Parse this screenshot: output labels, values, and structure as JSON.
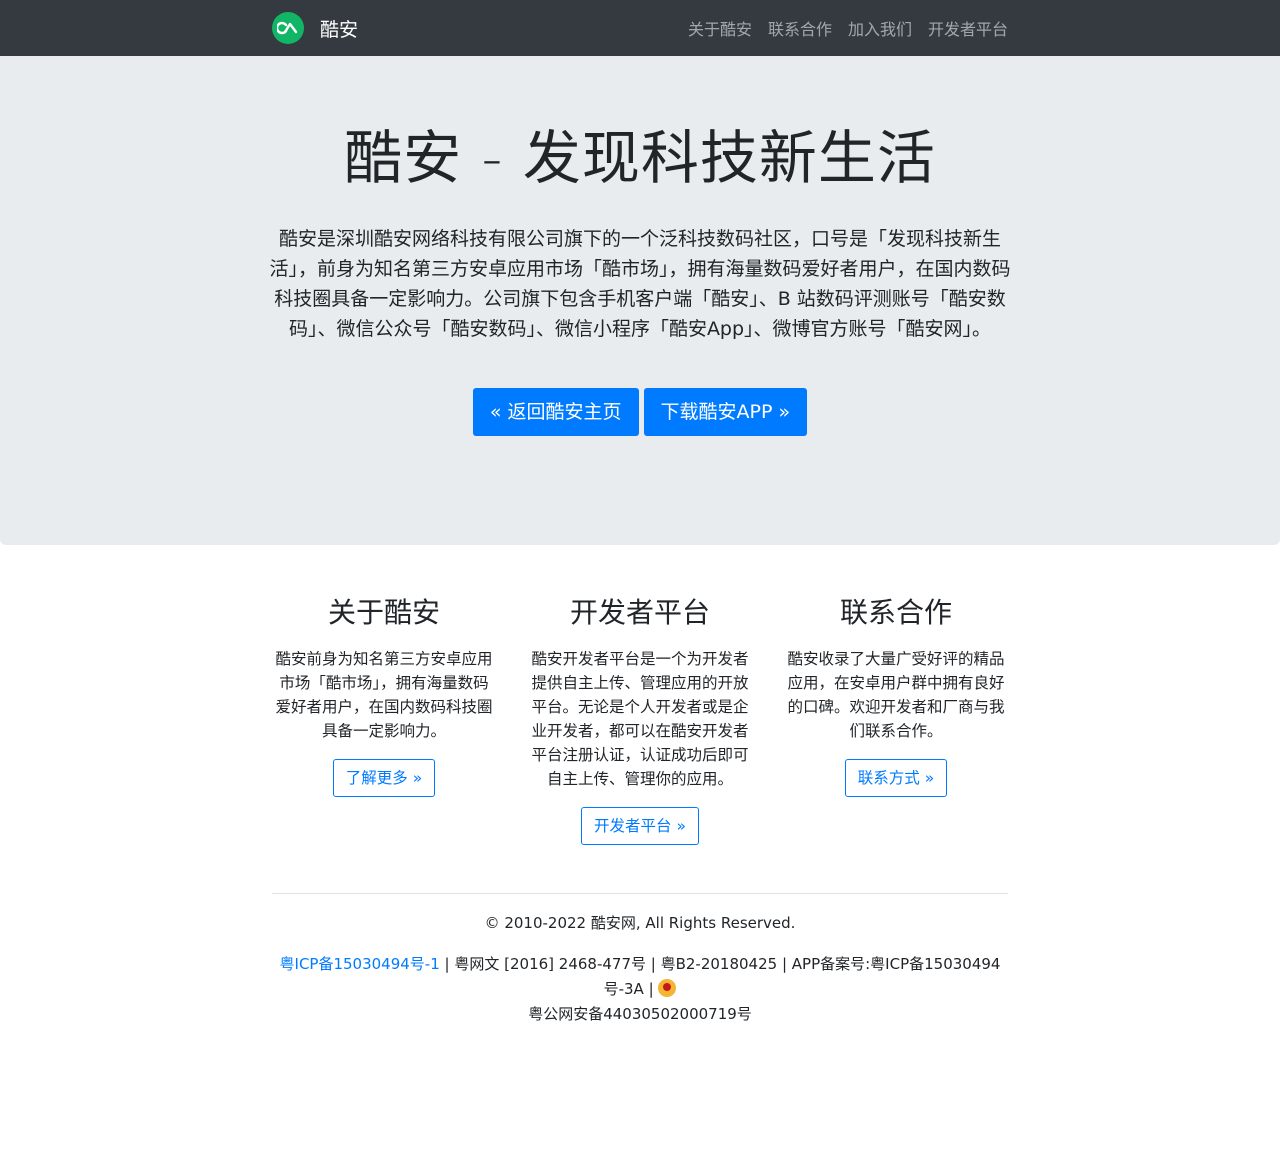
{
  "nav": {
    "brand": "酷安",
    "links": [
      "关于酷安",
      "联系合作",
      "加入我们",
      "开发者平台"
    ]
  },
  "hero": {
    "title": "酷安 - 发现科技新生活",
    "lead": "酷安是深圳酷安网络科技有限公司旗下的一个泛科技数码社区，口号是「发现科技新生活」，前身为知名第三方安卓应用市场「酷市场」，拥有海量数码爱好者用户，在国内数码科技圈具备一定影响力。公司旗下包含手机客户端「酷安」、B 站数码评测账号「酷安数码」、微信公众号「酷安数码」、微信小程序「酷安App」、微博官方账号「酷安网」。",
    "btn_home": "« 返回酷安主页",
    "btn_download": "下载酷安APP »"
  },
  "features": [
    {
      "title": "关于酷安",
      "text": "酷安前身为知名第三方安卓应用市场「酷市场」，拥有海量数码爱好者用户，在国内数码科技圈具备一定影响力。",
      "button": "了解更多 »"
    },
    {
      "title": "开发者平台",
      "text": "酷安开发者平台是一个为开发者提供自主上传、管理应用的开放平台。无论是个人开发者或是企业开发者，都可以在酷安开发者平台注册认证，认证成功后即可自主上传、管理你的应用。",
      "button": "开发者平台 »"
    },
    {
      "title": "联系合作",
      "text": "酷安收录了大量广受好评的精品应用，在安卓用户群中拥有良好的口碑。欢迎开发者和厂商与我们联系合作。",
      "button": "联系方式 »"
    }
  ],
  "footer": {
    "copyright": "© 2010-2022 酷安网, All Rights Reserved.",
    "icp_link": "粤ICP备15030494号-1",
    "licenses": " | 粤网文 [2016] 2468-477号 | 粤B2-20180425 | APP备案号:粤ICP备15030494号-3A | ",
    "police": "粤公网安备44030502000719号"
  },
  "colors": {
    "navbar_bg": "#343a40",
    "jumbotron_bg": "#e9ecef",
    "primary": "#007bff",
    "brand_green": "#11b566"
  },
  "icons": {
    "brand_logo": "coolapk-logo-icon",
    "police_badge": "police-badge-icon"
  }
}
